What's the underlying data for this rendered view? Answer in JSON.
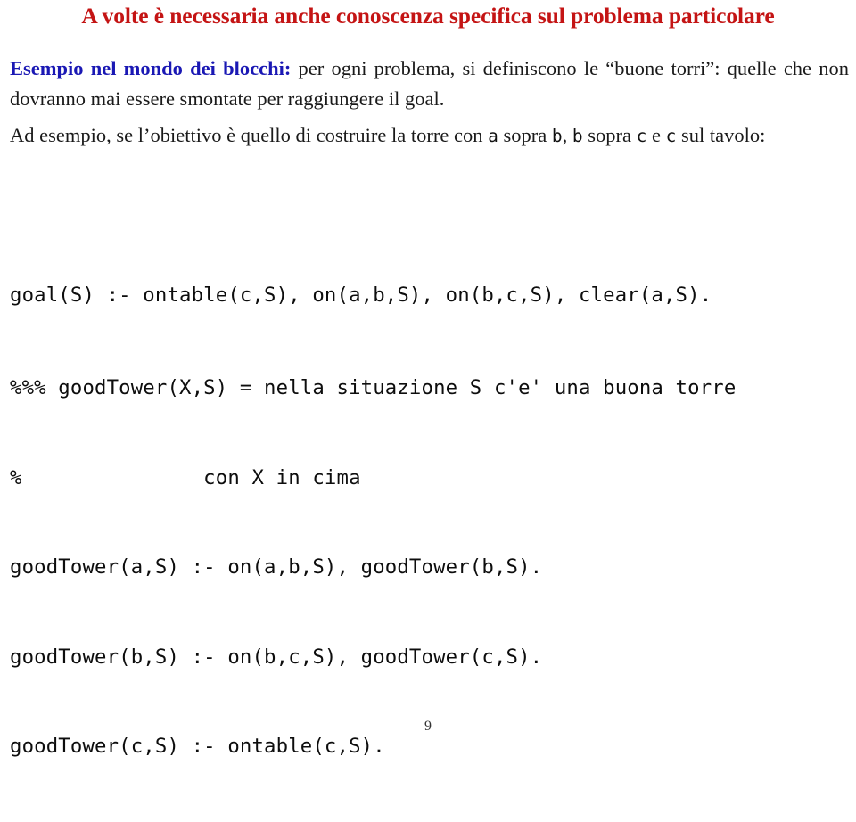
{
  "page": {
    "number": "9",
    "background_color": "#ffffff"
  },
  "colors": {
    "title_red": "#c41414",
    "lead_blue": "#1a18b4",
    "body_black": "#1a1a1a",
    "code_black": "#0d0d0d"
  },
  "title": {
    "text": "A volte è necessaria anche conoscenza specifica sul problema particolare"
  },
  "paragraphs": {
    "blocchi": {
      "lead": "Esempio nel mondo dei blocchi:",
      "rest": " per ogni problema, si definiscono le “buone torri”: quelle che non dovranno mai essere smontate per raggiungere il goal."
    },
    "esempio": {
      "part1": "Ad esempio, se l’obiettivo è quello di costruire la torre con ",
      "tt1": "a",
      "part2": " sopra ",
      "tt2": "b",
      "part3": ", ",
      "tt3": "b",
      "part4": " sopra ",
      "tt4": "c",
      "part5": " e ",
      "tt5": "c",
      "part6": " sul tavolo:"
    }
  },
  "code_blocks": {
    "goal": {
      "lines": [
        "goal(S) :- ontable(c,S), on(a,b,S), on(b,c,S), clear(a,S)."
      ]
    },
    "goodtower": {
      "lines": [
        "%%% goodTower(X,S) = nella situazione S c'e' una buona torre",
        "%               con X in cima",
        "goodTower(a,S) :- on(a,b,S), goodTower(b,S).",
        "goodTower(b,S) :- on(b,c,S), goodTower(c,S).",
        "goodTower(c,S) :- ontable(c,S)."
      ]
    }
  }
}
